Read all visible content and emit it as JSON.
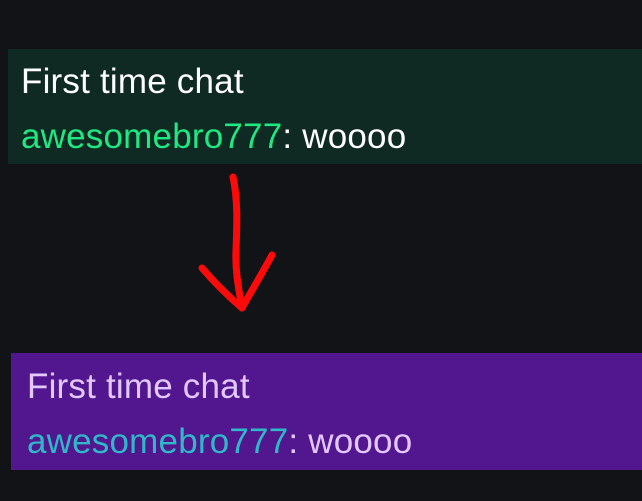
{
  "before": {
    "title": "First time chat",
    "username": "awesomebro777",
    "separator": ": ",
    "message": "woooo",
    "colors": {
      "background": "#0e2a22",
      "title": "#ffffff",
      "username": "#1ee882",
      "message": "#ffffff"
    }
  },
  "after": {
    "title": "First time chat",
    "username": "awesomebro777",
    "separator": ": ",
    "message": "woooo",
    "colors": {
      "background": "#52168f",
      "title": "#e2c8ff",
      "username": "#2fb8c8",
      "message": "#e2c8ff"
    }
  },
  "annotation": {
    "icon": "hand-drawn-down-arrow-icon",
    "color": "#ff0a0a"
  },
  "page_background": "#121317"
}
